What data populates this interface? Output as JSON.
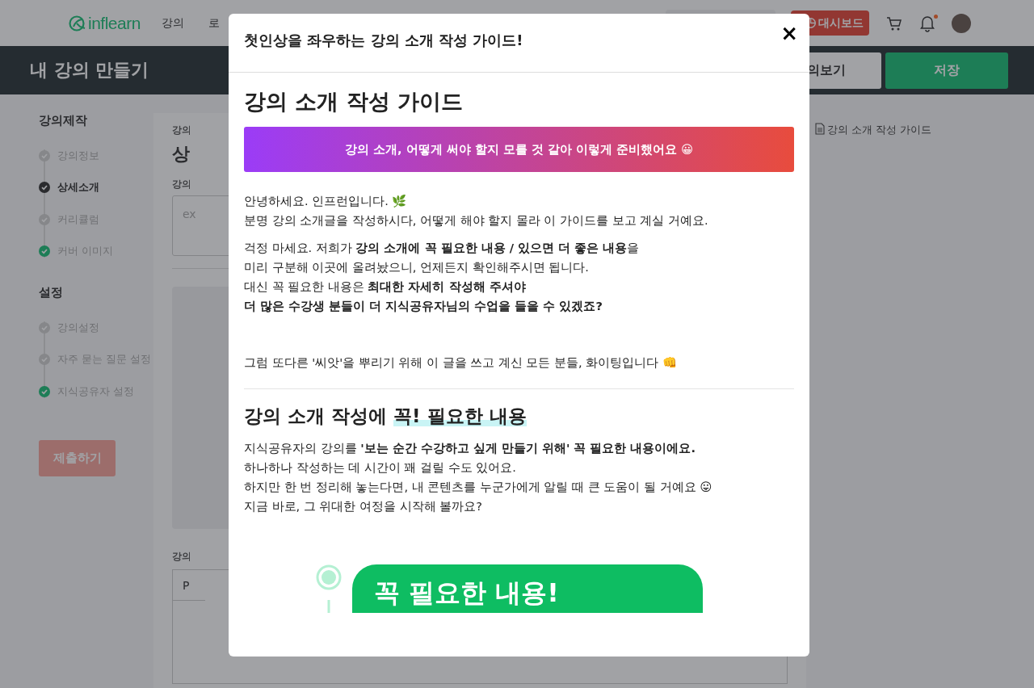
{
  "header": {
    "logo": "inflearn",
    "nav": [
      "강의",
      "로"
    ],
    "dashboard_button": "대시보드",
    "notifications": {
      "unread": true
    }
  },
  "title_bar": {
    "title": "내 강의 만들기",
    "preview_button": "의보기",
    "save_button": "저장"
  },
  "sidebar": {
    "sections": [
      {
        "title": "강의제작",
        "items": [
          {
            "label": "강의정보",
            "selected": false,
            "completed": false
          },
          {
            "label": "상세소개",
            "selected": true,
            "completed": false
          },
          {
            "label": "커리큘럼",
            "selected": false,
            "completed": false
          },
          {
            "label": "커버 이미지",
            "selected": false,
            "completed": true
          }
        ]
      },
      {
        "title": "설정",
        "items": [
          {
            "label": "강의설정",
            "selected": false,
            "completed": false
          },
          {
            "label": "자주 묻는 질문 설정",
            "selected": false,
            "completed": false
          },
          {
            "label": "지식공유자 설정",
            "selected": false,
            "completed": true
          }
        ]
      }
    ],
    "submit_button": {
      "label": "제출하기",
      "disabled": true
    }
  },
  "editor": {
    "breadcrumb": "강의",
    "heading": "상",
    "field_label": "강의",
    "field_placeholder": "ex",
    "section_label": "강의",
    "table_header": "P"
  },
  "guide_link": "강의 소개 작성 가이드",
  "modal": {
    "title": "첫인상을 좌우하는 강의 소개 작성 가이드!",
    "close": "×",
    "heading": "강의 소개 작성 가이드",
    "banner": "강의 소개, 어떻게 써야 할지 모를 것 같아 이렇게 준비했어요 😀",
    "paragraphs": [
      [
        "안녕하세요. 인프런입니다. 🌿",
        "분명 강의 소개글을 작성하시다, 어떻게 해야 할지 몰라 이 가이드를 보고 계실 거예요."
      ],
      [
        "걱정 마세요. 저희가 **강의 소개에 꼭 필요한 내용 / 있으면 더 좋은 내용**을",
        "미리 구분해 이곳에 올려놨으니, 언제든지 확인해주시면 됩니다.",
        "대신 꼭 필요한 내용은 **최대한 자세히 작성해 주셔야**",
        "**더 많은 수강생 분들이 더 지식공유자님의 수업을 들을 수 있겠죠?**"
      ],
      [
        "그럼 또다른 '씨앗'을 뿌리기 위해 이 글을 쓰고 계신 모든 분들, 화이팅입니다 👊"
      ]
    ],
    "section_heading": {
      "text": "강의 소개 작성에 ",
      "highlight": "꼭! 필요한 내용"
    },
    "section_paragraph": [
      "지식공유자의 강의를 **'보는 순간 수강하고 싶게 만들기 위해' 꼭 필요한 내용이에요.**",
      "하나하나 작성하는 데 시간이 꽤 걸릴 수도 있어요.",
      "하지만 한 번 정리해 놓는다면, 내 콘텐츠를 누군가에게 알릴 때 큰 도움이 될 거예요 😛",
      "지금 바로, 그 위대한 여정을 시작해 볼까요?"
    ],
    "step_banner": "꼭 필요한 내용!"
  }
}
